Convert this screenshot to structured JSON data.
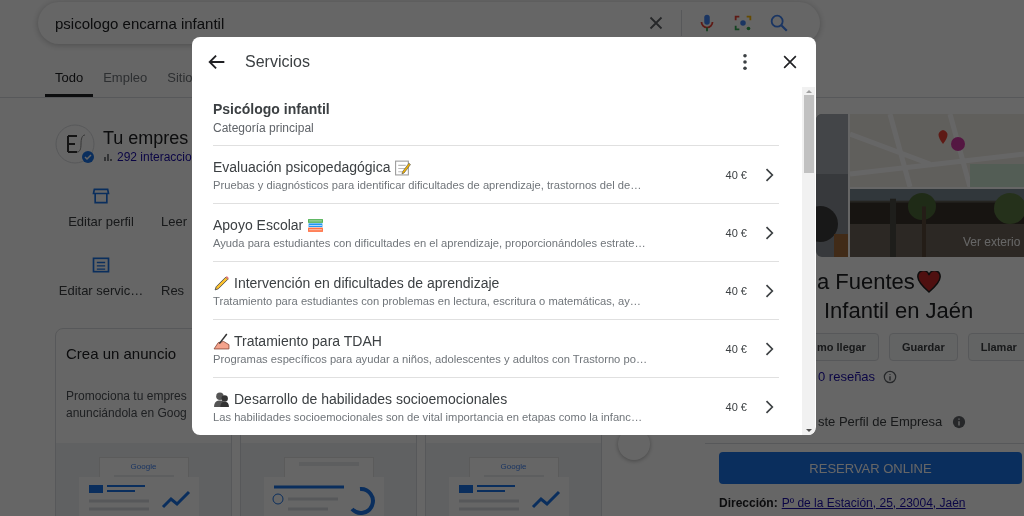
{
  "search": {
    "value": "psicologo encarna infantil"
  },
  "tabs": [
    {
      "label": "Todo",
      "selected": true
    },
    {
      "label": "Empleo",
      "selected": false
    },
    {
      "label": "Sitio",
      "selected": false
    }
  ],
  "business": {
    "title": "Tu empres",
    "interactions": "292 interaccio",
    "actions": [
      "Editar perfil",
      "Leer",
      "Editar servic…",
      "Res"
    ]
  },
  "ad_cards": [
    {
      "kind": "chart",
      "title": "Crea un anuncio",
      "lines": [
        "Promociona tu empres",
        "anunciándola en Goog"
      ],
      "logo": "Google"
    },
    {
      "kind": "store"
    },
    {
      "kind": "chart",
      "logo": "Google"
    }
  ],
  "place": {
    "photo_label": "Ver exterio",
    "name": "a Fuentes",
    "category": "Infantil en Jaén",
    "buttons": [
      "mo llegar",
      "Guardar",
      "Llamar"
    ],
    "reviews": "0 reseñas",
    "profile_note": "ste Perfil de Empresa",
    "book_button": "RESERVAR ONLINE",
    "address_label": "Dirección:",
    "address": "Pº de la Estación, 25, 23004, Jaén"
  },
  "dialog": {
    "title": "Servicios",
    "category": {
      "name": "Psicólogo infantil",
      "label": "Categoría principal"
    },
    "services": [
      {
        "name": "Evaluación psicopedagógica",
        "description": "Pruebas y diagnósticos para identificar dificultades de aprendizaje, trastornos del de…",
        "price": "40 €"
      },
      {
        "name": "Apoyo Escolar",
        "description": "Ayuda para estudiantes con dificultades en el aprendizaje, proporcionándoles estrate…",
        "price": "40 €"
      },
      {
        "name": "Intervención en dificultades de aprendizaje",
        "description": "Tratamiento para estudiantes con problemas en lectura, escritura o matemáticas, ay…",
        "price": "40 €"
      },
      {
        "name": "Tratamiento para TDAH",
        "description": "Programas específicos para ayudar a niños, adolescentes y adultos con Trastorno po…",
        "price": "40 €"
      },
      {
        "name": "Desarrollo de habilidades socioemocionales",
        "description": "Las habilidades socioemocionales son de vital importancia en etapas como la infanc…",
        "price": "40 €"
      }
    ]
  }
}
